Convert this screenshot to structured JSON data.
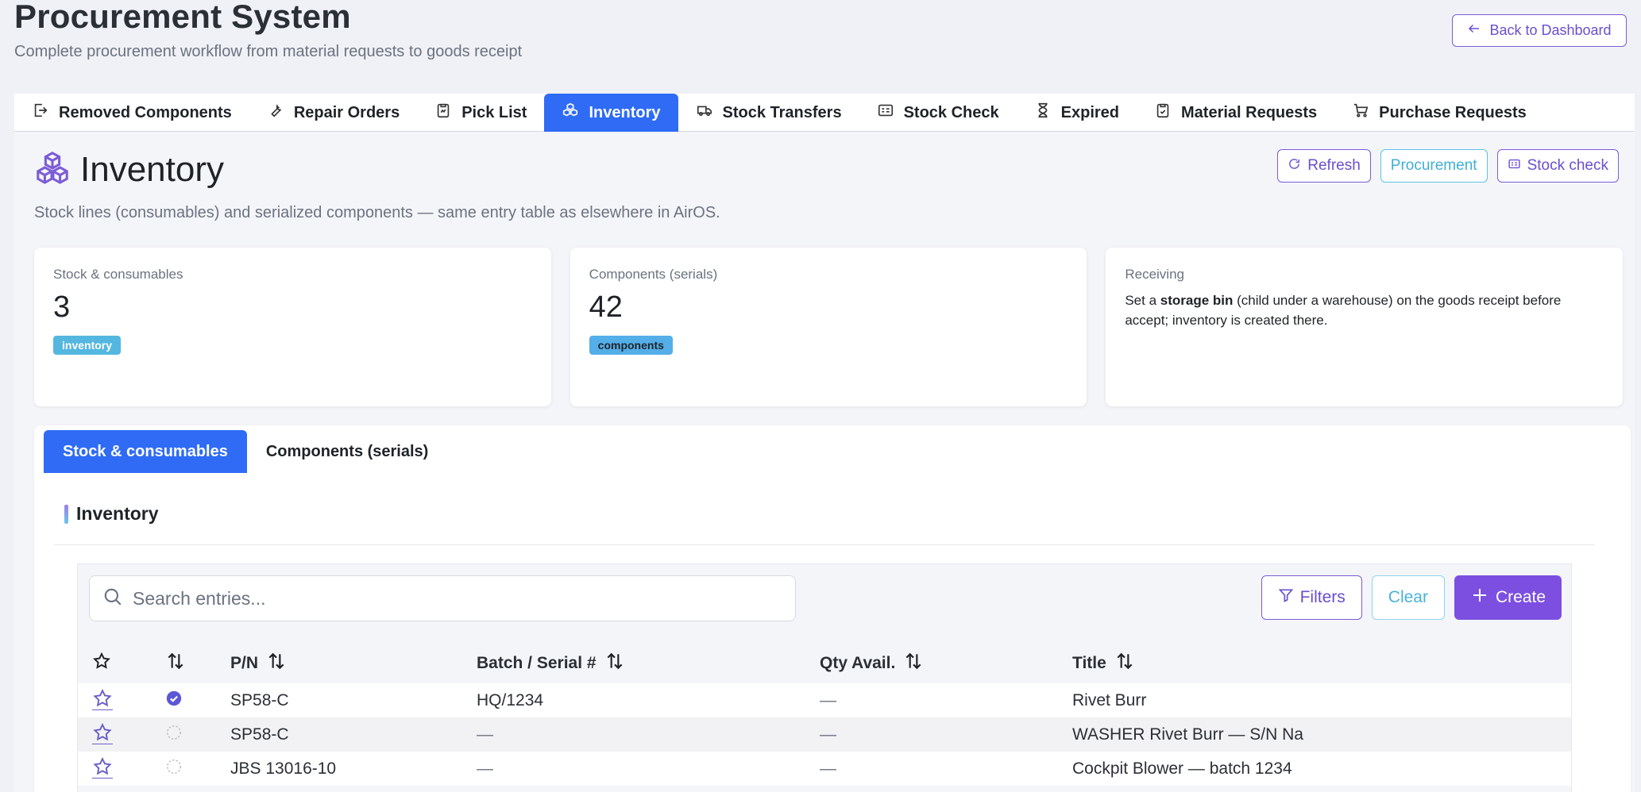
{
  "header": {
    "title": "Procurement System",
    "subtitle": "Complete procurement workflow from material requests to goods receipt",
    "back_label": "Back to Dashboard"
  },
  "tabs": [
    {
      "label": "Removed Components",
      "icon": "exit-icon"
    },
    {
      "label": "Repair Orders",
      "icon": "wrench-icon"
    },
    {
      "label": "Pick List",
      "icon": "clipboard-icon"
    },
    {
      "label": "Inventory",
      "icon": "boxes-icon",
      "active": true
    },
    {
      "label": "Stock Transfers",
      "icon": "truck-icon"
    },
    {
      "label": "Stock Check",
      "icon": "card-icon"
    },
    {
      "label": "Expired",
      "icon": "hourglass-icon"
    },
    {
      "label": "Material Requests",
      "icon": "clipboard-check-icon"
    },
    {
      "label": "Purchase Requests",
      "icon": "cart-icon"
    }
  ],
  "inventory": {
    "title": "Inventory",
    "description": "Stock lines (consumables) and serialized components — same entry table as elsewhere in AirOS.",
    "actions": {
      "refresh": "Refresh",
      "procurement": "Procurement",
      "stock_check": "Stock check"
    }
  },
  "stats": {
    "stock": {
      "label": "Stock & consumables",
      "value": "3",
      "badge": "inventory"
    },
    "components": {
      "label": "Components (serials)",
      "value": "42",
      "badge": "components"
    },
    "receiving": {
      "label": "Receiving",
      "text_before": "Set a ",
      "text_bold": "storage bin",
      "text_after": " (child under a warehouse) on the goods receipt before accept; inventory is created there."
    }
  },
  "sub_tabs": {
    "stock": "Stock & consumables",
    "components": "Components (serials)"
  },
  "section_title": "Inventory",
  "table": {
    "search_placeholder": "Search entries...",
    "filters_label": "Filters",
    "clear_label": "Clear",
    "create_label": "Create",
    "columns": {
      "pn": "P/N",
      "batch": "Batch / Serial #",
      "qty": "Qty Avail.",
      "title": "Title"
    },
    "rows": [
      {
        "pn": "SP58-C",
        "batch": "HQ/1234",
        "qty": "—",
        "title": "Rivet Burr",
        "checked": true
      },
      {
        "pn": "SP58-C",
        "batch": "—",
        "qty": "—",
        "title": "WASHER Rivet Burr — S/N Na",
        "checked": false
      },
      {
        "pn": "JBS 13016-10",
        "batch": "—",
        "qty": "—",
        "title": "Cockpit Blower — batch 1234",
        "checked": false
      }
    ]
  },
  "colors": {
    "accent_blue": "#2f6bf5",
    "accent_purple": "#7c4fe0",
    "accent_cyan": "#54b7e0"
  }
}
